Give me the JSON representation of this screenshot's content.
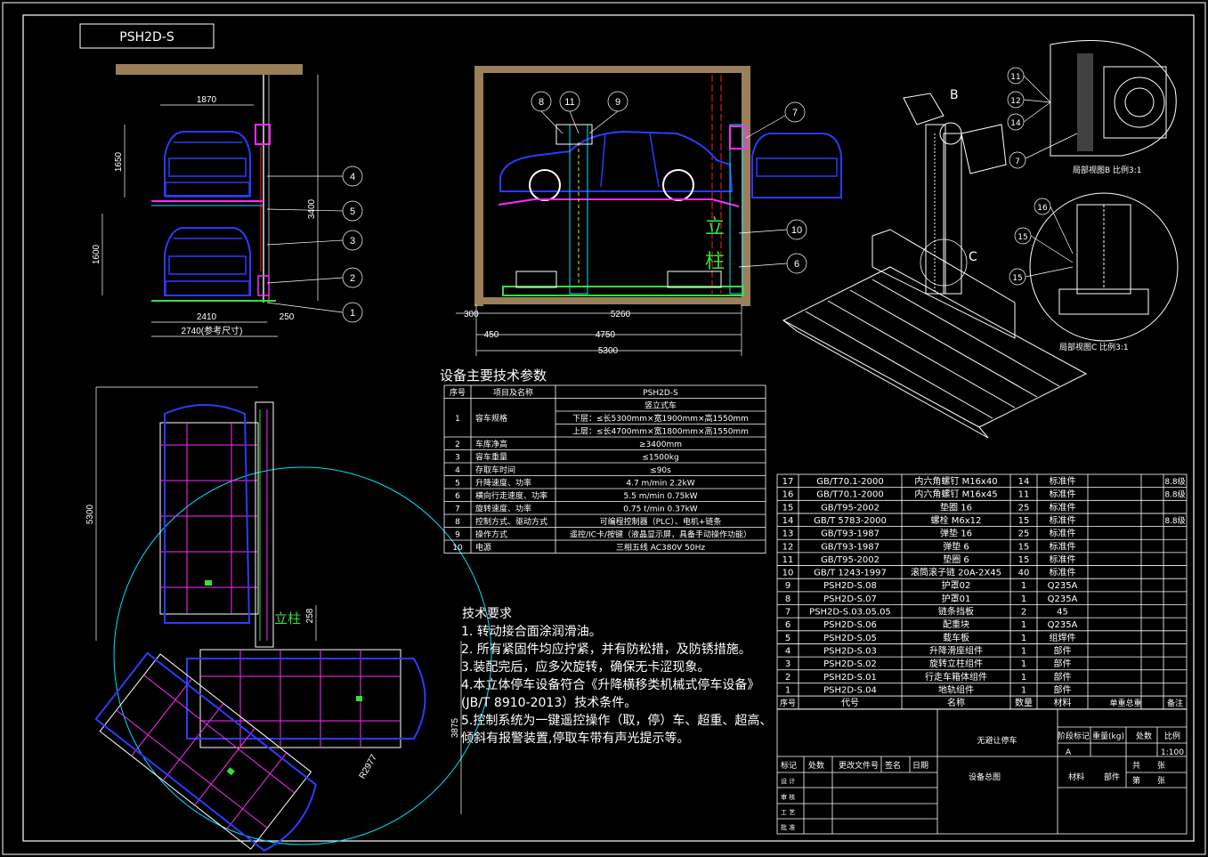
{
  "title_block_label": "PSH2D-S",
  "colors": {
    "background": "#000000",
    "line": "#ffffff",
    "car": "#2a3cff",
    "cyan": "#00e0ff",
    "magenta": "#ff2cff",
    "green": "#36e03a",
    "yellow": "#f5e300",
    "red": "#ff2020"
  },
  "front_view": {
    "dims": {
      "top_width": "1870",
      "upper_height": "1650",
      "lower_height": "1600",
      "total_height": "3400",
      "width_2410": "2410",
      "width_250": "250",
      "width_2740": "2740(参考尺寸)"
    },
    "balloons": [
      "4",
      "5",
      "3",
      "2",
      "1"
    ]
  },
  "side_view": {
    "dims": {
      "d300": "300",
      "d5260": "5260",
      "d450": "450",
      "d4750": "4750",
      "d5300": "5300"
    },
    "balloons": [
      "8",
      "11",
      "9",
      "7",
      "10",
      "6"
    ],
    "pillar_label": [
      "立",
      "柱"
    ]
  },
  "detail_views": {
    "label_b": "B",
    "label_c": "C",
    "detail_b_balloons": [
      "11",
      "12",
      "14",
      "7"
    ],
    "detail_b_caption": "局部视图B  比例3:1",
    "detail_c_balloons": [
      "16",
      "15",
      "15"
    ],
    "detail_c_caption": "局部视图C  比例3:1"
  },
  "plan_view": {
    "dims": {
      "d5300": "5300",
      "d3875": "3875",
      "d258": "258",
      "radius": "R2977"
    },
    "pillar_label": "立柱"
  },
  "spec_table": {
    "title": "设备主要技术参数",
    "headers": [
      "序号",
      "项目及名称",
      "PSH2D-S"
    ],
    "rows": [
      {
        "no": "",
        "name": "",
        "value": "竖立式车"
      },
      {
        "no": "1",
        "name": "容车规格",
        "value": "下层：≤长5300mm×宽1900mm×高1550mm"
      },
      {
        "no": "",
        "name": "",
        "value": "上层：≤长4700mm×宽1800mm×高1550mm"
      },
      {
        "no": "2",
        "name": "车库净高",
        "value": "≥3400mm"
      },
      {
        "no": "3",
        "name": "容车重量",
        "value": "≤1500kg"
      },
      {
        "no": "4",
        "name": "存取车时间",
        "value": "≤90s"
      },
      {
        "no": "5",
        "name": "升降速度、功率",
        "value": "4.7 m/min   2.2kW"
      },
      {
        "no": "6",
        "name": "横向行走速度、功率",
        "value": "5.5 m/min  0.75kW"
      },
      {
        "no": "7",
        "name": "旋转速度、功率",
        "value": "0.75 t/min  0.37kW"
      },
      {
        "no": "8",
        "name": "控制方式、驱动方式",
        "value": "可编程控制器（PLC）、电机+链条"
      },
      {
        "no": "9",
        "name": "操作方式",
        "value": "遥控/IC卡/按键（液晶显示屏，具备手动操作功能）"
      },
      {
        "no": "10",
        "name": "电源",
        "value": "三相五线 AC380V 50Hz"
      }
    ]
  },
  "requirements": {
    "title": "技术要求",
    "lines": [
      "1. 转动接合面涂润滑油。",
      "2. 所有紧固件均应拧紧，并有防松措，及防锈措施。",
      "3.装配完后，应多次旋转，确保无卡涩现象。",
      "4.本立体停车设备符合《升降横移类机械式停车设备》",
      "(JB/T 8910-2013）技术条件。",
      "5.控制系统为一键遥控操作（取，停）车、超重、超高、",
      "倾斜有报警装置,停取车带有声光提示等。"
    ]
  },
  "bom": {
    "rows": [
      {
        "no": "17",
        "code": "GB/T70.1-2000",
        "name": "内六角螺钉 M16x40",
        "qty": "14",
        "mat": "标准件",
        "note": "8.8级"
      },
      {
        "no": "16",
        "code": "GB/T70.1-2000",
        "name": "内六角螺钉 M16x45",
        "qty": "11",
        "mat": "标准件",
        "note": "8.8级"
      },
      {
        "no": "15",
        "code": "GB/T95-2002",
        "name": "垫圈 16",
        "qty": "25",
        "mat": "标准件",
        "note": ""
      },
      {
        "no": "14",
        "code": "GB/T 5783-2000",
        "name": "螺栓  M6x12",
        "qty": "15",
        "mat": "标准件",
        "note": "8.8级"
      },
      {
        "no": "13",
        "code": "GB/T93-1987",
        "name": "弹垫 16",
        "qty": "25",
        "mat": "标准件",
        "note": ""
      },
      {
        "no": "12",
        "code": "GB/T93-1987",
        "name": "弹垫 6",
        "qty": "15",
        "mat": "标准件",
        "note": ""
      },
      {
        "no": "11",
        "code": "GB/T95-2002",
        "name": "垫圈 6",
        "qty": "15",
        "mat": "标准件",
        "note": ""
      },
      {
        "no": "10",
        "code": "GB/T 1243-1997",
        "name": "滚筒滚子链 20A-2X45",
        "qty": "40",
        "mat": "标准件",
        "note": ""
      },
      {
        "no": "9",
        "code": "PSH2D-S.08",
        "name": "护罩02",
        "qty": "1",
        "mat": "Q235A",
        "note": ""
      },
      {
        "no": "8",
        "code": "PSH2D-S.07",
        "name": "护罩01",
        "qty": "1",
        "mat": "Q235A",
        "note": ""
      },
      {
        "no": "7",
        "code": "PSH2D-S.03.05.05",
        "name": "链条挡板",
        "qty": "2",
        "mat": "45",
        "note": ""
      },
      {
        "no": "6",
        "code": "PSH2D-S.06",
        "name": "配重块",
        "qty": "1",
        "mat": "Q235A",
        "note": ""
      },
      {
        "no": "5",
        "code": "PSH2D-S.05",
        "name": "载车板",
        "qty": "1",
        "mat": "组焊件",
        "note": ""
      },
      {
        "no": "4",
        "code": "PSH2D-S.03",
        "name": "升降滑座组件",
        "qty": "1",
        "mat": "部件",
        "note": ""
      },
      {
        "no": "3",
        "code": "PSH2D-S.02",
        "name": "旋转立柱组件",
        "qty": "1",
        "mat": "部件",
        "note": ""
      },
      {
        "no": "2",
        "code": "PSH2D-S.01",
        "name": "行走车箱体组件",
        "qty": "1",
        "mat": "部件",
        "note": ""
      },
      {
        "no": "1",
        "code": "PSH2D-S.04",
        "name": "地轨组件",
        "qty": "1",
        "mat": "部件",
        "note": ""
      }
    ],
    "header": {
      "no": "序号",
      "code": "代号",
      "name": "名称",
      "qty": "数量",
      "mat": "材料",
      "weight": "单重总重",
      "note": "备注"
    }
  },
  "title_block": {
    "product": "无避让停车",
    "drawing": "设备总图",
    "stage": "阶段标记",
    "weight": "重量(kg)",
    "scale": "比例",
    "scale_val": "1:100",
    "stage_val": "A",
    "material": "材料",
    "part": "部件",
    "sheet_total": "共",
    "sheet_no": "第",
    "zhang": "张",
    "mark": "标记",
    "count": "处数",
    "doc": "更改文件号",
    "sign": "签名",
    "date": "日期",
    "design": "设 计",
    "check": "审 核",
    "craft": "工 艺",
    "approve": "批 准"
  }
}
